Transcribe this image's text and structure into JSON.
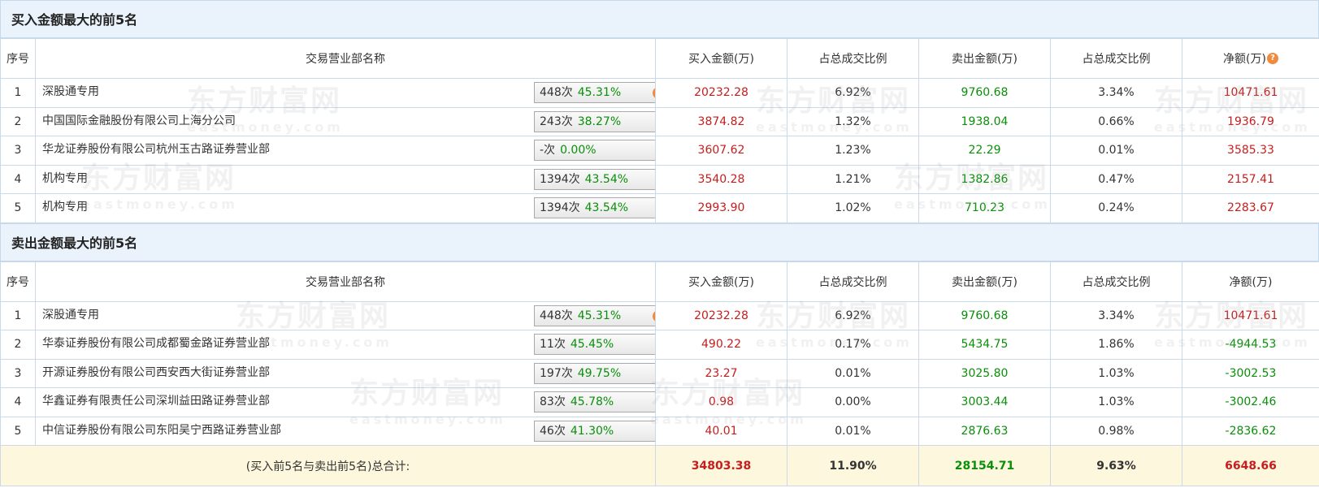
{
  "buy_section": {
    "title": "买入金额最大的前5名",
    "headers": [
      "序号",
      "交易营业部名称",
      "买入金额(万)",
      "占总成交比例",
      "卖出金额(万)",
      "占总成交比例",
      "净额(万)"
    ],
    "rows": [
      {
        "idx": "1",
        "name": "深股通专用",
        "count": "448次",
        "pct": "45.31%",
        "icon": "question-icon",
        "buy": "20232.28",
        "buy_ratio": "6.92%",
        "sell": "9760.68",
        "sell_ratio": "3.34%",
        "net": "10471.61"
      },
      {
        "idx": "2",
        "name": "中国国际金融股份有限公司上海分公司",
        "count": "243次",
        "pct": "38.27%",
        "icon": "arrow-right-icon",
        "buy": "3874.82",
        "buy_ratio": "1.32%",
        "sell": "1938.04",
        "sell_ratio": "0.66%",
        "net": "1936.79"
      },
      {
        "idx": "3",
        "name": "华龙证券股份有限公司杭州玉古路证券营业部",
        "count": "-次",
        "pct": "0.00%",
        "icon": "arrow-right-icon",
        "buy": "3607.62",
        "buy_ratio": "1.23%",
        "sell": "22.29",
        "sell_ratio": "0.01%",
        "net": "3585.33"
      },
      {
        "idx": "4",
        "name": "机构专用",
        "count": "1394次",
        "pct": "43.54%",
        "icon": "arrow-right-icon",
        "buy": "3540.28",
        "buy_ratio": "1.21%",
        "sell": "1382.86",
        "sell_ratio": "0.47%",
        "net": "2157.41"
      },
      {
        "idx": "5",
        "name": "机构专用",
        "count": "1394次",
        "pct": "43.54%",
        "icon": "arrow-right-icon",
        "buy": "2993.90",
        "buy_ratio": "1.02%",
        "sell": "710.23",
        "sell_ratio": "0.24%",
        "net": "2283.67"
      }
    ]
  },
  "sell_section": {
    "title": "卖出金额最大的前5名",
    "headers": [
      "序号",
      "交易营业部名称",
      "买入金额(万)",
      "占总成交比例",
      "卖出金额(万)",
      "占总成交比例",
      "净额(万)"
    ],
    "rows": [
      {
        "idx": "1",
        "name": "深股通专用",
        "count": "448次",
        "pct": "45.31%",
        "icon": "question-icon",
        "buy": "20232.28",
        "buy_ratio": "6.92%",
        "sell": "9760.68",
        "sell_ratio": "3.34%",
        "net": "10471.61"
      },
      {
        "idx": "2",
        "name": "华泰证券股份有限公司成都蜀金路证券营业部",
        "count": "11次",
        "pct": "45.45%",
        "icon": "arrow-right-icon",
        "buy": "490.22",
        "buy_ratio": "0.17%",
        "sell": "5434.75",
        "sell_ratio": "1.86%",
        "net": "-4944.53"
      },
      {
        "idx": "3",
        "name": "开源证券股份有限公司西安西大街证券营业部",
        "count": "197次",
        "pct": "49.75%",
        "icon": "arrow-right-icon",
        "buy": "23.27",
        "buy_ratio": "0.01%",
        "sell": "3025.80",
        "sell_ratio": "1.03%",
        "net": "-3002.53"
      },
      {
        "idx": "4",
        "name": "华鑫证券有限责任公司深圳益田路证券营业部",
        "count": "83次",
        "pct": "45.78%",
        "icon": "arrow-right-icon",
        "buy": "0.98",
        "buy_ratio": "0.00%",
        "sell": "3003.44",
        "sell_ratio": "1.03%",
        "net": "-3002.46"
      },
      {
        "idx": "5",
        "name": "中信证券股份有限公司东阳吴宁西路证券营业部",
        "count": "46次",
        "pct": "41.30%",
        "icon": "arrow-right-icon",
        "buy": "40.01",
        "buy_ratio": "0.01%",
        "sell": "2876.63",
        "sell_ratio": "0.98%",
        "net": "-2836.62"
      }
    ]
  },
  "total": {
    "label": "(买入前5名与卖出前5名)总合计:",
    "buy": "34803.38",
    "buy_ratio": "11.90%",
    "sell": "28154.71",
    "sell_ratio": "9.63%",
    "net": "6648.66"
  },
  "watermark": {
    "text": "东方财富网",
    "sub": "eastmoney.com"
  },
  "colors": {
    "positive": "#c51e1e",
    "sell": "#0a8f0a",
    "header_bg": "#eaf3fb",
    "total_bg": "#fdf7dd",
    "icon_orange": "#f08a3c",
    "arrow_blue": "#2a5ea8"
  }
}
